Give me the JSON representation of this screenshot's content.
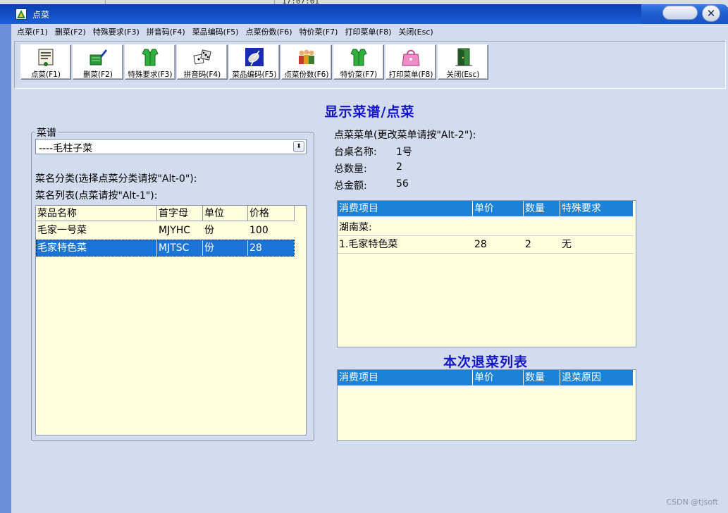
{
  "backdrop": {
    "clock_text": "17:07:01"
  },
  "window": {
    "title": "点菜"
  },
  "menubar": [
    "点菜(F1)",
    "删菜(F2)",
    "特殊要求(F3)",
    "拼音码(F4)",
    "菜品编码(F5)",
    "点菜份数(F6)",
    "特价菜(F7)",
    "打印菜单(F8)",
    "关闭(Esc)"
  ],
  "toolbar": [
    {
      "label": "点菜(F1)",
      "icon": "order-menu-icon"
    },
    {
      "label": "删菜(F2)",
      "icon": "delete-edit-icon"
    },
    {
      "label": "特殊要求(F3)",
      "icon": "green-vest-icon"
    },
    {
      "label": "拼音码(F4)",
      "icon": "dice-icon"
    },
    {
      "label": "菜品编码(F5)",
      "icon": "satellite-icon"
    },
    {
      "label": "点菜份数(F6)",
      "icon": "people-group-icon"
    },
    {
      "label": "特价菜(F7)",
      "icon": "green-vest-icon"
    },
    {
      "label": "打印菜单(F8)",
      "icon": "pink-handbag-icon"
    },
    {
      "label": "关闭(Esc)",
      "icon": "exit-door-icon"
    }
  ],
  "main_heading": "显示菜谱/点菜",
  "left": {
    "group_label": "菜谱",
    "menu_select_value": "----毛柱子菜",
    "category_label": "菜名分类(选择点菜分类请按\"Alt-0\"):",
    "list_label": "菜名列表(点菜请按\"Alt-1\"):",
    "columns": [
      "菜品名称",
      "首字母",
      "单位",
      "价格"
    ],
    "rows": [
      {
        "name": "毛家一号菜",
        "initials": "MJYHC",
        "unit": "份",
        "price": "100"
      },
      {
        "name": "毛家特色菜",
        "initials": "MJTSC",
        "unit": "份",
        "price": "28",
        "selected": true
      }
    ]
  },
  "right": {
    "order_title": "点菜菜单(更改菜单请按\"Alt-2\"):",
    "table_label": "台桌名称:",
    "table_value": "1号",
    "qty_label": "总数量:",
    "qty_value": "2",
    "amount_label": "总金额:",
    "amount_value": "56",
    "order_columns": [
      "消费项目",
      "单价",
      "数量",
      "特殊要求"
    ],
    "order_category": "湖南菜:",
    "order_rows": [
      {
        "item": "1.毛家特色菜",
        "price": "28",
        "qty": "2",
        "note": "无"
      }
    ],
    "return_heading": "本次退菜列表",
    "return_columns": [
      "消费项目",
      "单价",
      "数量",
      "退菜原因"
    ]
  },
  "watermark": "CSDN @tjsoft",
  "colors": {
    "title_blue": "#1416c8",
    "header_blue": "#1b82d8",
    "selection_blue": "#1a74d8",
    "grid_bg": "#ffffdf",
    "client_bg": "#d3dcef"
  }
}
